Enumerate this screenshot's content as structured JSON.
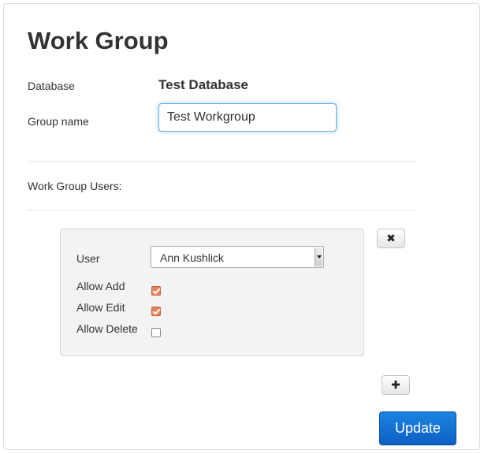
{
  "page": {
    "title": "Work Group"
  },
  "form": {
    "database_label": "Database",
    "database_value": "Test Database",
    "group_name_label": "Group name",
    "group_name_value": "Test Workgroup",
    "users_section_label": "Work Group Users:"
  },
  "user_entry": {
    "user_label": "User",
    "user_selected": "Ann Kushlick",
    "allow_add_label": "Allow Add",
    "allow_add_checked": true,
    "allow_edit_label": "Allow Edit",
    "allow_edit_checked": true,
    "allow_delete_label": "Allow Delete",
    "allow_delete_checked": false
  },
  "buttons": {
    "remove_symbol": "✖",
    "add_symbol": "✚",
    "update_label": "Update"
  },
  "colors": {
    "accent": "#0e5fc4",
    "checkbox_checked": "#e8825a",
    "focus_border": "#66afe9"
  }
}
